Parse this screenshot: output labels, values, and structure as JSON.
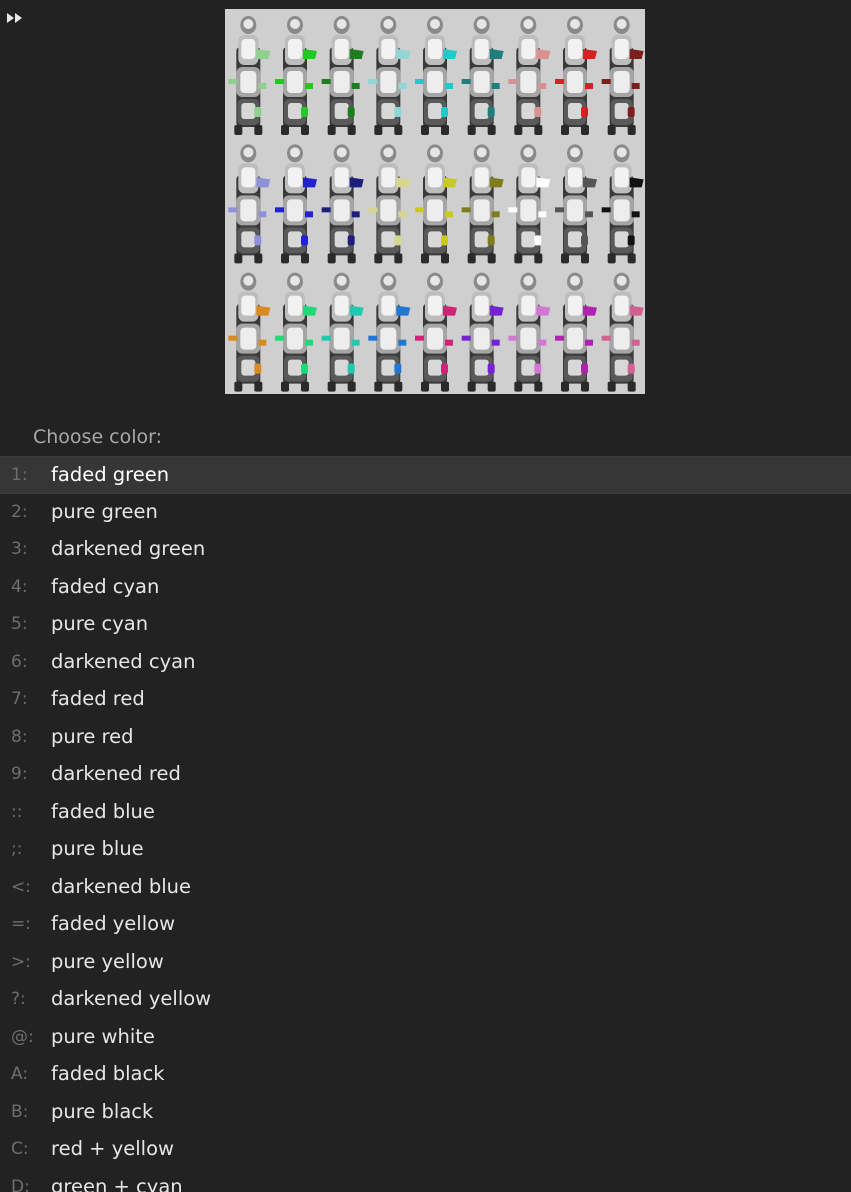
{
  "toolbar": {
    "fast_forward_icon": "fast-forward-icon"
  },
  "preview": {
    "tint_colors": [
      [
        "#8fd08f",
        "#22c922",
        "#1e7d1e",
        "#8fd6d6",
        "#22c9c9",
        "#1e7d7d",
        "#d99090",
        "#d22222",
        "#7d1e1e"
      ],
      [
        "#9090d9",
        "#2222d2",
        "#1e1e7d",
        "#d6d68f",
        "#c9c922",
        "#7d7d1e",
        "#ffffff",
        "#555555",
        "#111111"
      ],
      [
        "#d98a22",
        "#22d97a",
        "#22c9b0",
        "#2277d2",
        "#d22277",
        "#7722d2",
        "#d277d2",
        "#b022b0",
        "#d26090"
      ]
    ]
  },
  "prompt": "Choose color:",
  "selected_index": 0,
  "options": [
    {
      "key": "1:",
      "label": "faded green"
    },
    {
      "key": "2:",
      "label": "pure green"
    },
    {
      "key": "3:",
      "label": "darkened green"
    },
    {
      "key": "4:",
      "label": "faded cyan"
    },
    {
      "key": "5:",
      "label": "pure cyan"
    },
    {
      "key": "6:",
      "label": "darkened cyan"
    },
    {
      "key": "7:",
      "label": "faded red"
    },
    {
      "key": "8:",
      "label": "pure red"
    },
    {
      "key": "9:",
      "label": "darkened red"
    },
    {
      "key": "::",
      "label": "faded blue"
    },
    {
      "key": ";:",
      "label": "pure blue"
    },
    {
      "key": "<:",
      "label": "darkened blue"
    },
    {
      "key": "=:",
      "label": "faded yellow"
    },
    {
      "key": ">:",
      "label": "pure yellow"
    },
    {
      "key": "?:",
      "label": "darkened yellow"
    },
    {
      "key": "@:",
      "label": "pure white"
    },
    {
      "key": "A:",
      "label": "faded black"
    },
    {
      "key": "B:",
      "label": "pure black"
    },
    {
      "key": "C:",
      "label": "red + yellow"
    },
    {
      "key": "D:",
      "label": "green + cyan"
    }
  ]
}
